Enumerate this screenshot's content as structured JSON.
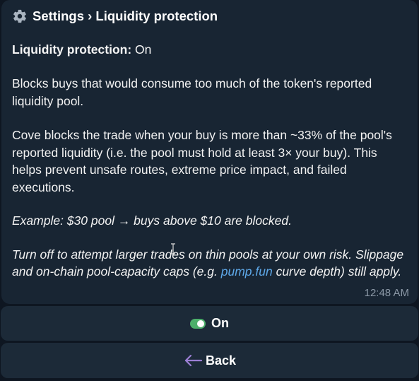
{
  "header": {
    "icon": "gear-icon",
    "breadcrumb": "Settings › Liquidity protection"
  },
  "status": {
    "label": "Liquidity protection:",
    "value": "On"
  },
  "paragraphs": {
    "p1": "Blocks buys that would consume too much of the token's reported liquidity pool.",
    "p2": "Cove blocks the trade when your buy is more than ~33% of the pool's reported liquidity (i.e. the pool must hold at least 3× your buy). This helps prevent unsafe routes, extreme price impact, and failed executions.",
    "p3": "Example: $30 pool → buys above $10 are blocked.",
    "p4_a": "Turn off to attempt larger trades on thin pools at your own risk. Slippage and on-chain pool-capacity caps (e.g. ",
    "p4_link": "pump.fun",
    "p4_b": " curve depth) still apply."
  },
  "timestamp": "12:48 AM",
  "buttons": {
    "toggle_label": "On",
    "back_label": "Back"
  },
  "colors": {
    "background": "#0e1621",
    "bubble": "#182533",
    "button": "#1c2a38",
    "link": "#5ea8e8",
    "toggle_on": "#4caf6a",
    "back_arrow": "#9b7fd4"
  }
}
